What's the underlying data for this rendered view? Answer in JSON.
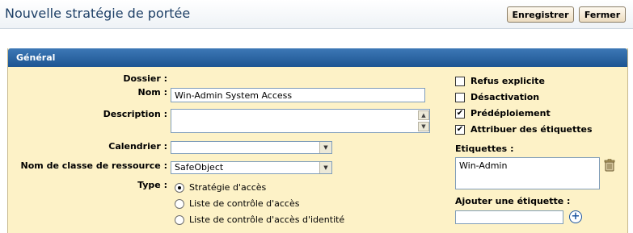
{
  "header": {
    "title": "Nouvelle stratégie de portée",
    "save_label": "Enregistrer",
    "close_label": "Fermer"
  },
  "section": {
    "title": "Général"
  },
  "form": {
    "folder_label": "Dossier :",
    "name_label": "Nom :",
    "name_value": "Win-Admin System Access",
    "description_label": "Description :",
    "description_value": "",
    "calendar_label": "Calendrier :",
    "calendar_value": "",
    "resource_class_label": "Nom de classe de ressource :",
    "resource_class_value": "SafeObject",
    "type_label": "Type :",
    "type_options": [
      {
        "label": "Stratégie d'accès",
        "selected": true
      },
      {
        "label": "Liste de contrôle d'accès",
        "selected": false
      },
      {
        "label": "Liste de contrôle d'accès d'identité",
        "selected": false
      }
    ]
  },
  "options": {
    "checkboxes": [
      {
        "label": "Refus explicite",
        "checked": false
      },
      {
        "label": "Désactivation",
        "checked": false
      },
      {
        "label": "Prédéploiement",
        "checked": true
      },
      {
        "label": "Attribuer des étiquettes",
        "checked": true
      }
    ],
    "tags_label": "Etiquettes :",
    "tags": [
      "Win-Admin"
    ],
    "add_tag_label": "Ajouter une étiquette :",
    "add_tag_value": ""
  },
  "icons": {
    "check": "check-icon",
    "delete": "trash-icon",
    "add": "add-icon",
    "dropdown": "chevron-down-icon"
  },
  "colors": {
    "header_blue": "#1d5592",
    "panel_bg": "#fdf2c7",
    "title_text": "#1d3f66"
  }
}
